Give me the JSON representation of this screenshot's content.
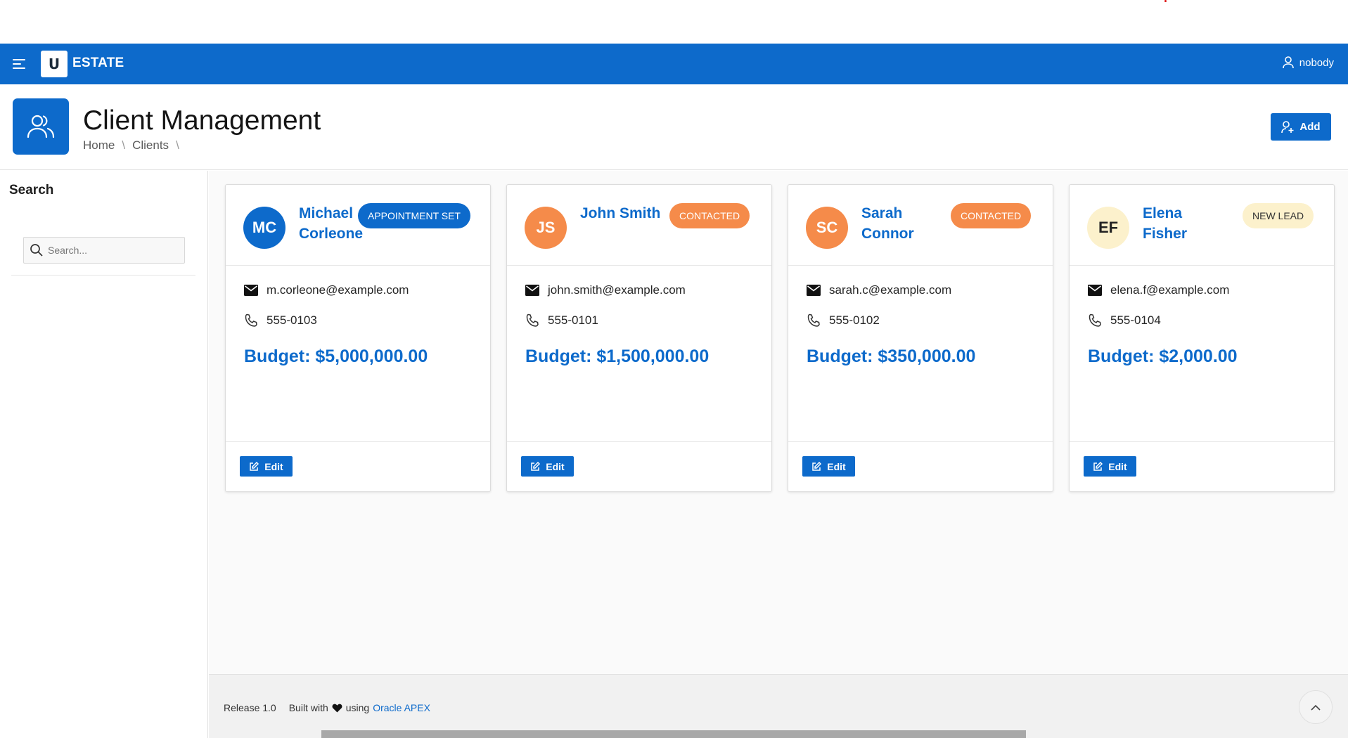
{
  "header": {
    "logo_letter": "U",
    "app_name": "ESTATE",
    "user_name": "nobody",
    "color": "#0d6acb"
  },
  "hero": {
    "title": "Client Management",
    "breadcrumb": [
      "Home",
      "Clients"
    ],
    "add_label": "Add",
    "icon": "users-icon"
  },
  "sidebar": {
    "title": "Search",
    "search_placeholder": "Search..."
  },
  "clients": [
    {
      "initials": "MC",
      "name": "Michael Corleone",
      "status": "APPOINTMENT SET",
      "status_color": "#0d6acb",
      "email": "m.corleone@example.com",
      "phone": "555-0103",
      "budget": "Budget: $5,000,000.00",
      "avatar_color": "#0d6acb",
      "edit_label": "Edit"
    },
    {
      "initials": "JS",
      "name": "John Smith",
      "status": "CONTACTED",
      "status_color": "#f58b4a",
      "email": "john.smith@example.com",
      "phone": "555-0101",
      "budget": "Budget: $1,500,000.00",
      "avatar_color": "#f58b4a",
      "edit_label": "Edit"
    },
    {
      "initials": "SC",
      "name": "Sarah Connor",
      "status": "CONTACTED",
      "status_color": "#f58b4a",
      "email": "sarah.c@example.com",
      "phone": "555-0102",
      "budget": "Budget: $350,000.00",
      "avatar_color": "#f58b4a",
      "edit_label": "Edit"
    },
    {
      "initials": "EF",
      "name": "Elena Fisher",
      "status": "NEW LEAD",
      "status_color": "#fcf1cc",
      "email": "elena.f@example.com",
      "phone": "555-0104",
      "budget": "Budget: $2,000.00",
      "avatar_color": "#fcf1cc",
      "edit_label": "Edit"
    }
  ],
  "footer": {
    "release": "Release 1.0",
    "built_with": "Built with",
    "using": "using",
    "link": "Oracle APEX"
  }
}
